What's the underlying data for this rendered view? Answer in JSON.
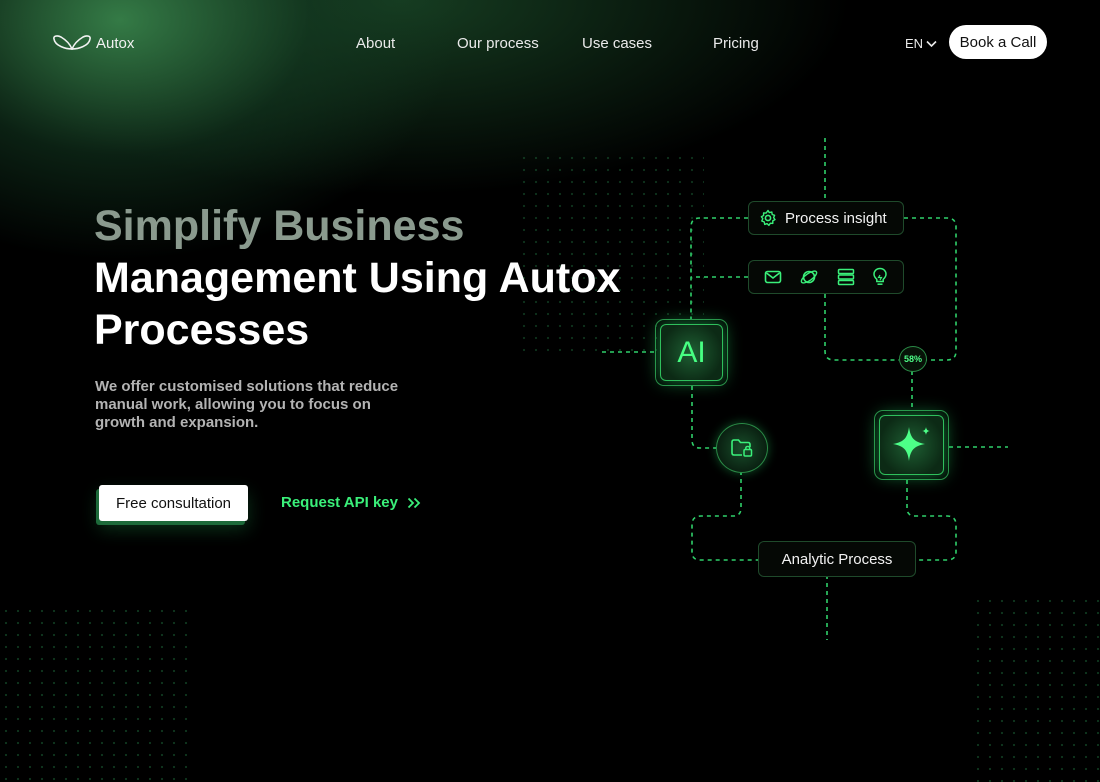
{
  "brand": {
    "name": "Autox"
  },
  "nav": {
    "links": [
      "About",
      "Our process",
      "Use cases",
      "Pricing"
    ],
    "language": "EN",
    "cta": "Book a Call"
  },
  "hero": {
    "title_line1": "Simplify Business",
    "title_line2": "Management Using Autox",
    "title_line3": "Processes",
    "subtitle": "We offer customised solutions that reduce manual work, allowing you to focus on growth and expansion.",
    "primary_button": "Free consultation",
    "secondary_link": "Request API key"
  },
  "diagram": {
    "process_insight": "Process insight",
    "ai_label": "AI",
    "progress_badge": "58%",
    "analytic_process": "Analytic Process",
    "tool_icons": [
      "mail-icon",
      "planet-icon",
      "stack-icon",
      "lightbulb-icon"
    ]
  },
  "colors": {
    "accent": "#3af07a",
    "background": "#000000",
    "node_border": "#2a8a46"
  }
}
